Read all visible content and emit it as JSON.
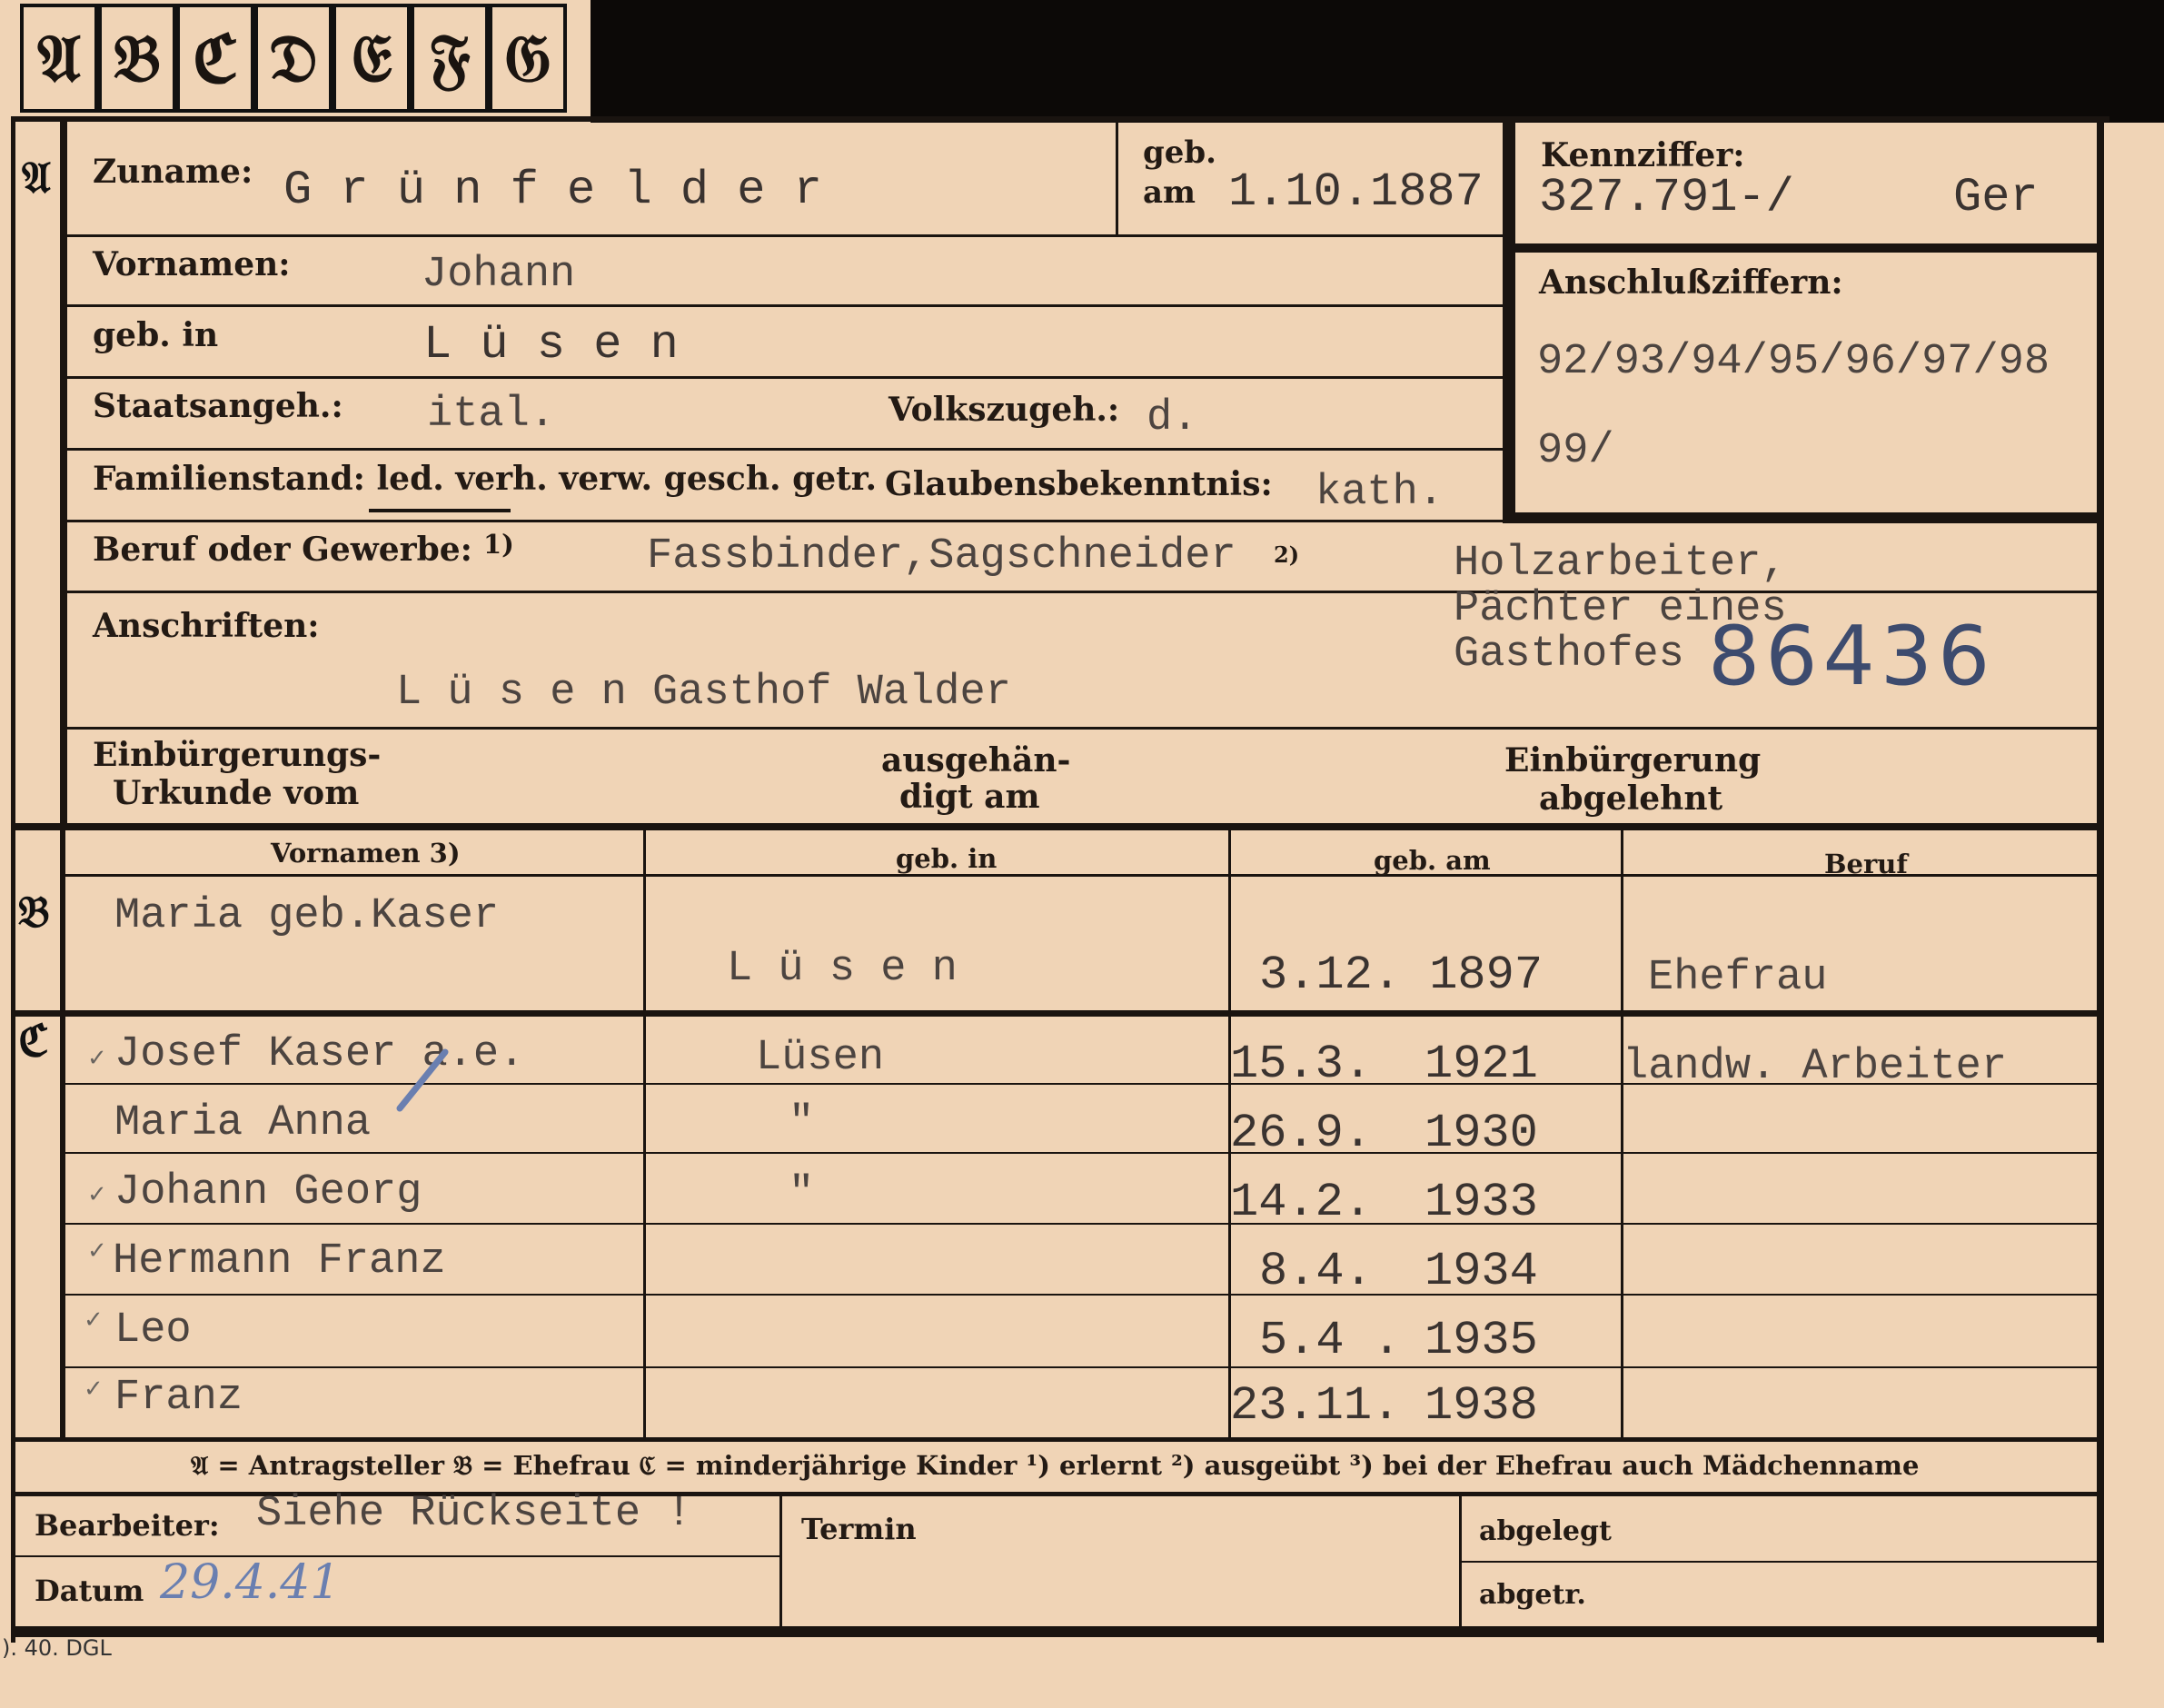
{
  "tabs": [
    "𝔄",
    "𝔅",
    "ℭ",
    "𝔇",
    "𝔈",
    "𝔉",
    "𝔊"
  ],
  "sections": {
    "a": "𝔄",
    "b": "𝔅",
    "c": "ℭ"
  },
  "labels": {
    "zuname": "Zuname:",
    "geb_am_1": "geb.",
    "geb_am_2": "am",
    "kennziffer": "Kennziffer:",
    "vornamen": "Vornamen:",
    "anschlussziffern": "Anschlußziffern:",
    "geb_in": "geb. in",
    "staatsangeh": "Staatsangeh.:",
    "volkszugeh": "Volkszugeh.:",
    "familienstand": "Familienstand: led. verh. verw. gesch. getr.",
    "glaubensbekenntnis": "Glaubensbekenntnis:",
    "beruf": "Beruf oder Gewerbe:",
    "beruf_sup": "1)",
    "anschriften": "Anschriften:",
    "einbuergerung_1": "Einbürgerungs-",
    "einbuergerung_2": "Urkunde vom",
    "ausgehaendigt_1": "ausgehän-",
    "ausgehaendigt_2": "digt am",
    "abgelehnt_1": "Einbürgerung",
    "abgelehnt_2": "abgelehnt",
    "col_vornamen": "Vornamen 3)",
    "col_geb_in": "geb. in",
    "col_geb_am": "geb. am",
    "col_beruf": "Beruf",
    "bearbeiter": "Bearbeiter:",
    "termin": "Termin",
    "abgelegt": "abgelegt",
    "datum": "Datum",
    "abgetr": "abgetr."
  },
  "applicant": {
    "zuname": "G r ü n f e l d e r",
    "geb_am": "1.10.1887",
    "kennziffer": "327.791-/",
    "kennziffer_suffix": "Ger",
    "vornamen": "Johann",
    "anschlussziffern_1": "92/93/94/95/96/97/98",
    "anschlussziffern_2": "99/",
    "geb_in": "L ü s e n",
    "staatsangeh": "ital.",
    "volkszugeh": "d.",
    "glaubensbekenntnis": "kath.",
    "beruf": "Fassbinder,Sagschneider",
    "beruf_sup": "2)",
    "beruf_extra_1": "Holzarbeiter,",
    "beruf_extra_2": "Pächter eines",
    "beruf_extra_3": "Gasthofes",
    "stamp_number": "86436",
    "anschrift": "L ü s e n Gasthof Walder"
  },
  "wife": {
    "vornamen": "Maria geb.Kaser",
    "geb_in": "L ü s e n",
    "geb_am": "3.12. 1897",
    "beruf": "Ehefrau"
  },
  "children": [
    {
      "mark": "✓",
      "name": "Josef Kaser a.e.",
      "geb_in": "Lüsen",
      "day": "15.3.",
      "year": "1921",
      "beruf": "landw. Arbeiter"
    },
    {
      "mark": "",
      "name": "Maria Anna",
      "geb_in": "\"",
      "day": "26.9.",
      "year": "1930",
      "beruf": ""
    },
    {
      "mark": "✓",
      "name": "Johann Georg",
      "geb_in": "\"",
      "day": "14.2.",
      "year": "1933",
      "beruf": ""
    },
    {
      "mark": "✓",
      "name": "Hermann Franz",
      "geb_in": "",
      "day": "8.4.",
      "year": "1934",
      "beruf": ""
    },
    {
      "mark": "✓",
      "name": "Leo",
      "geb_in": "",
      "day": "5.4 .",
      "year": "1935",
      "beruf": ""
    },
    {
      "mark": "✓",
      "name": "Franz",
      "geb_in": "",
      "day": "23.11.",
      "year": "1938",
      "beruf": ""
    }
  ],
  "footer_legend": "𝔄 = Antragsteller   𝔅 = Ehefrau   ℭ = minderjährige Kinder   ¹) erlernt   ²) ausgeübt   ³) bei der Ehefrau auch Mädchenname",
  "bearbeiter_value": "Siehe Rückseite !",
  "datum_value": "29.4.41",
  "print_code": "). 40. DGL",
  "colors": {
    "card": "#f0d4b6",
    "ink": "#1a1410",
    "stamp": "#3d4b6e",
    "pencil": "#6a7fb0"
  }
}
